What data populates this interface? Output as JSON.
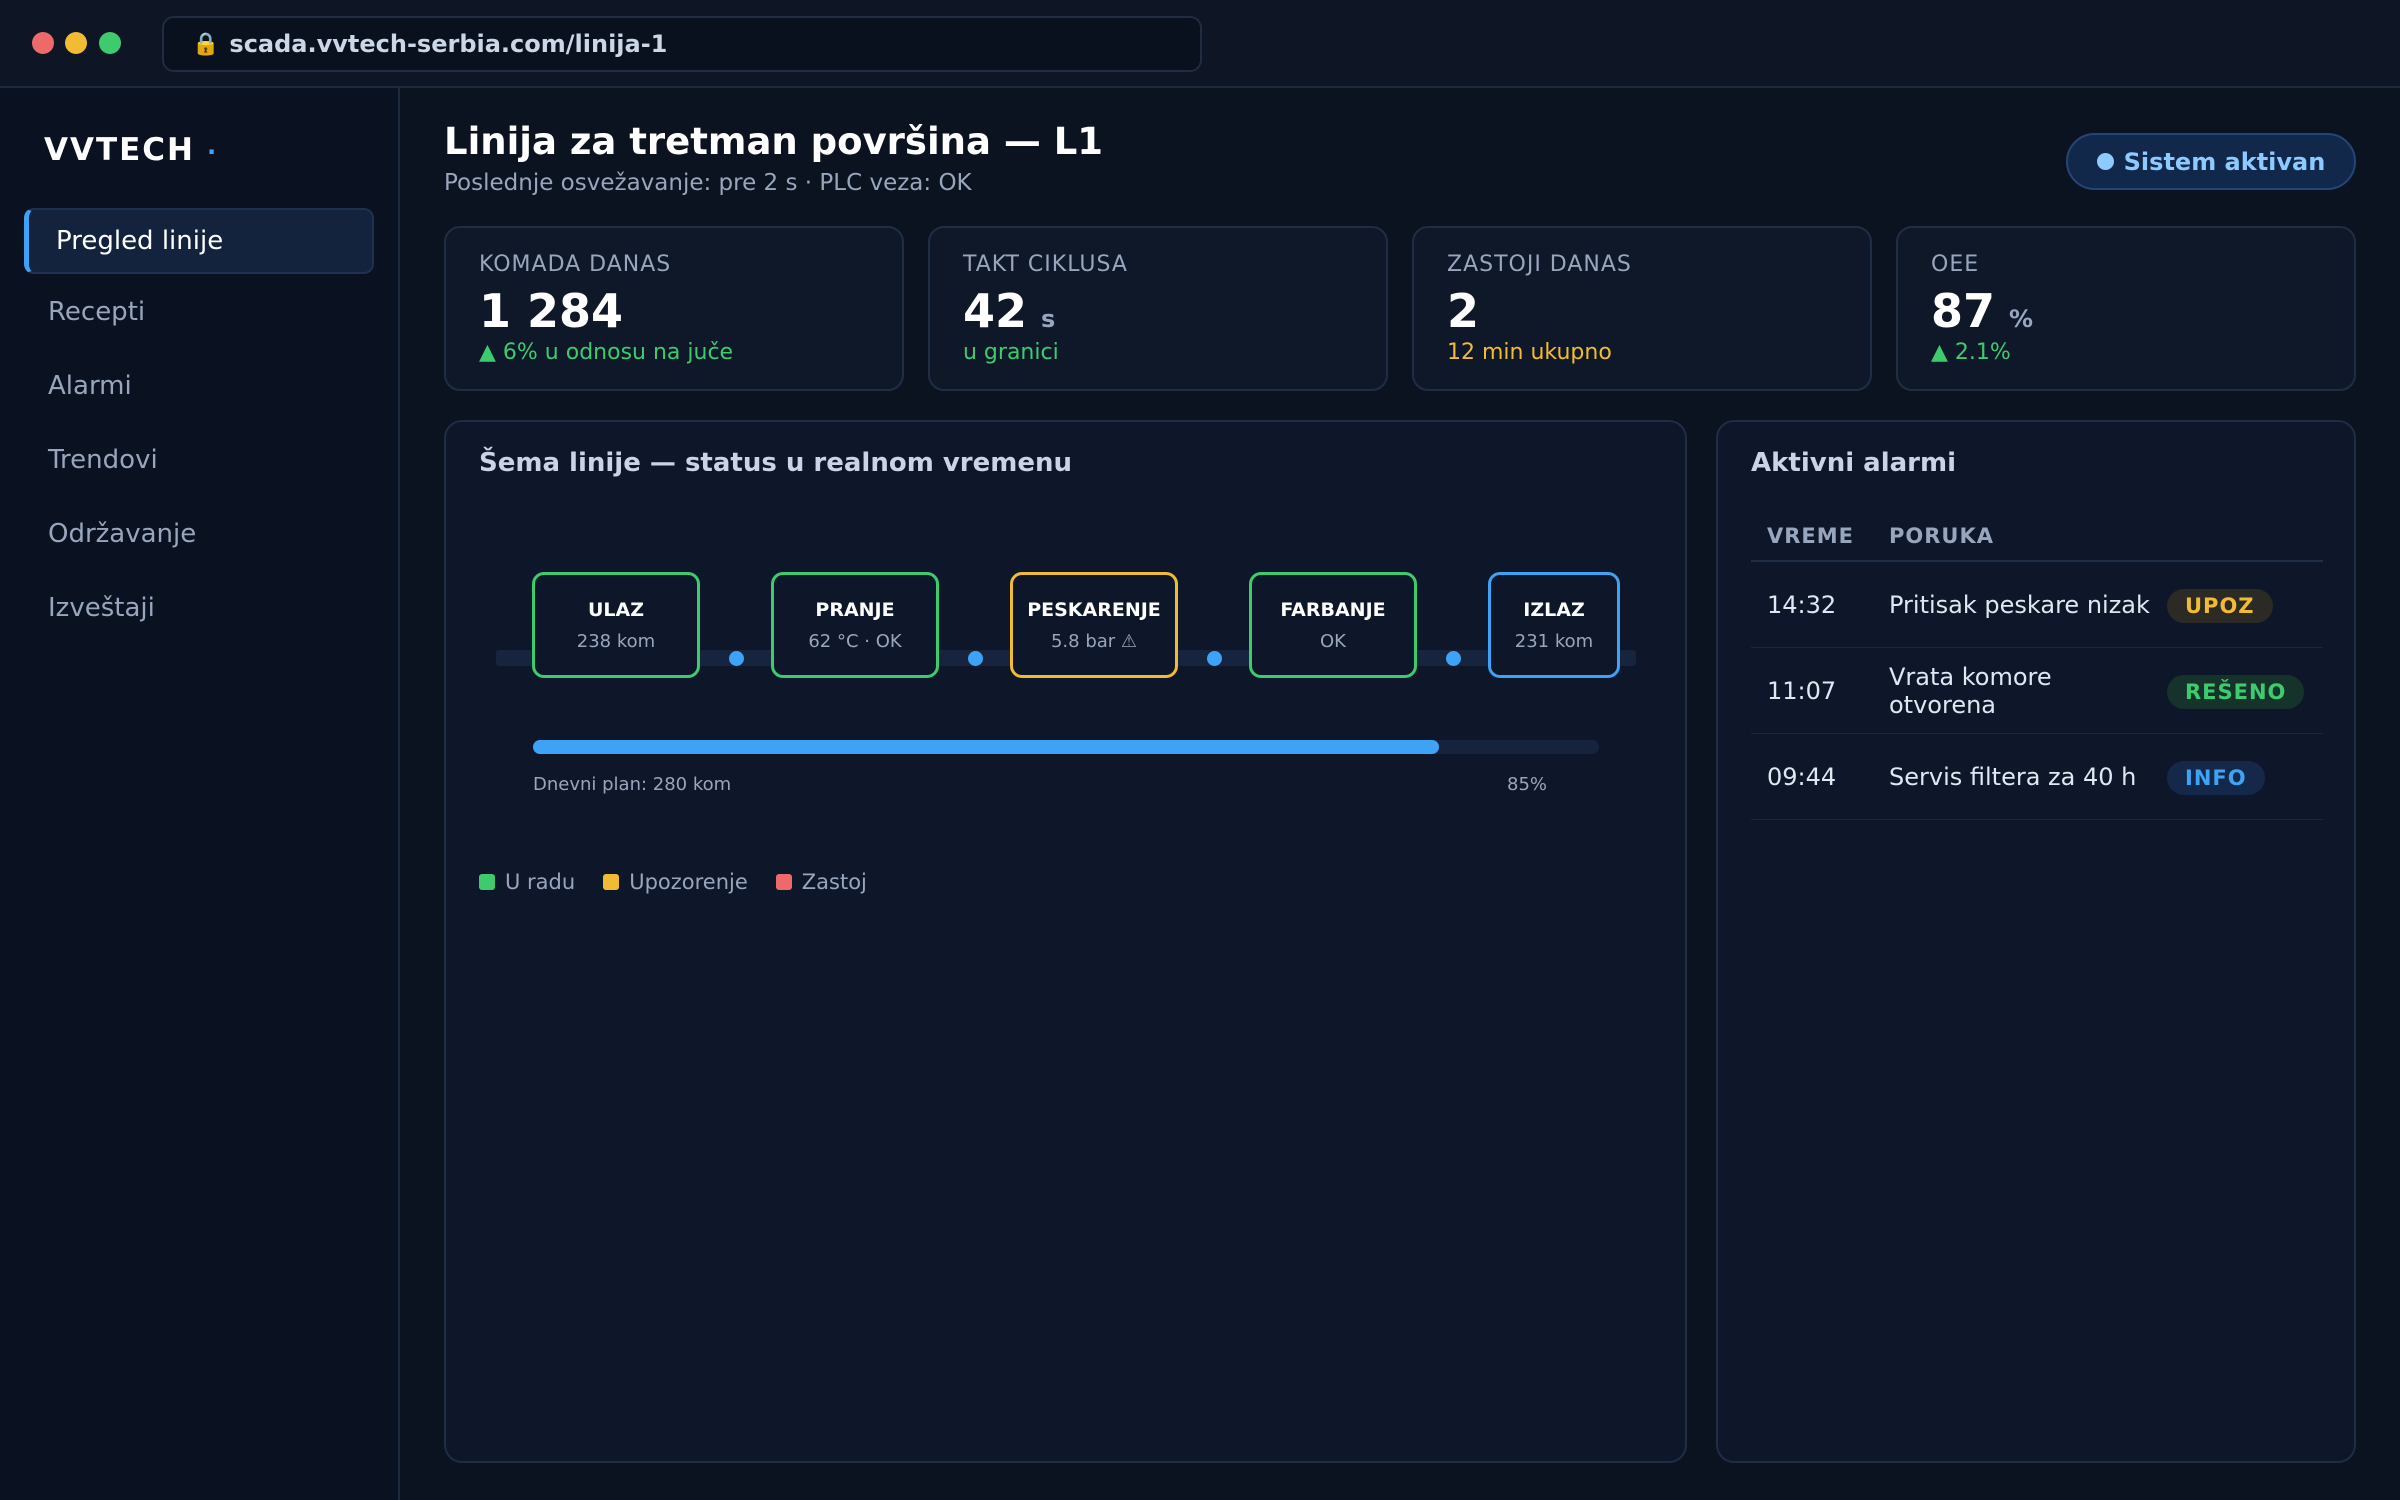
{
  "browser": {
    "url": "scada.vvtech-serbia.com/linija-1",
    "lock_icon": "🔒"
  },
  "sidebar": {
    "logo": "VVTECH",
    "logo_dot": "·",
    "items": [
      {
        "label": "Pregled linije",
        "active": true
      },
      {
        "label": "Recepti"
      },
      {
        "label": "Alarmi"
      },
      {
        "label": "Trendovi"
      },
      {
        "label": "Održavanje"
      },
      {
        "label": "Izveštaji"
      }
    ]
  },
  "header": {
    "title": "Linija za tretman površina — L1",
    "subtitle": "Poslednje osvežavanje: pre 2 s · PLC veza: OK",
    "status": "Sistem aktivan"
  },
  "kpis": [
    {
      "label": "KOMADA DANAS",
      "value": "1 284",
      "unit": "",
      "note": "▲ 6% u odnosu na juče",
      "note_status": "good"
    },
    {
      "label": "TAKT CIKLUSA",
      "value": "42",
      "unit": "s",
      "note": "u granici",
      "note_status": "good"
    },
    {
      "label": "ZASTOJI DANAS",
      "value": "2",
      "unit": "",
      "note": "12 min ukupno",
      "note_status": "warn"
    },
    {
      "label": "OEE",
      "value": "87",
      "unit": "%",
      "note": "▲ 2.1%",
      "note_status": "good"
    }
  ],
  "schematic": {
    "title": "Šema linije — status u realnom vremenu",
    "stations": [
      {
        "name": "ULAZ",
        "value": "238 kom",
        "status": "ok"
      },
      {
        "name": "PRANJE",
        "value": "62 °C · OK",
        "status": "ok"
      },
      {
        "name": "PESKARENJE",
        "value": "5.8 bar ⚠",
        "status": "warning"
      },
      {
        "name": "FARBANJE",
        "value": "OK",
        "status": "ok"
      },
      {
        "name": "IZLAZ",
        "value": "231 kom",
        "status": "info"
      }
    ],
    "plan_label": "Dnevni plan: 280 kom",
    "plan_percent_text": "85%",
    "plan_fraction": 0.85,
    "legend": [
      {
        "label": "U radu",
        "color": "#3ecb6e"
      },
      {
        "label": "Upozorenje",
        "color": "#f1bc33"
      },
      {
        "label": "Zastoj",
        "color": "#ee6a6a"
      }
    ]
  },
  "alarms": {
    "title": "Aktivni alarmi",
    "columns": [
      "VREME",
      "PORUKA"
    ],
    "rows": [
      {
        "time": "14:32",
        "message": "Pritisak peskare nizak",
        "badge": "UPOZ",
        "badge_type": "upoz"
      },
      {
        "time": "11:07",
        "message": "Vrata komore otvorena",
        "badge": "REŠENO",
        "badge_type": "reseno"
      },
      {
        "time": "09:44",
        "message": "Servis filtera za 40 h",
        "badge": "INFO",
        "badge_type": "info"
      }
    ]
  },
  "colors": {
    "accent": "#3ea2f5",
    "ok": "#3ecb6e",
    "warning": "#f1bc33",
    "error": "#ee6a6a",
    "background": "#0b1220"
  }
}
